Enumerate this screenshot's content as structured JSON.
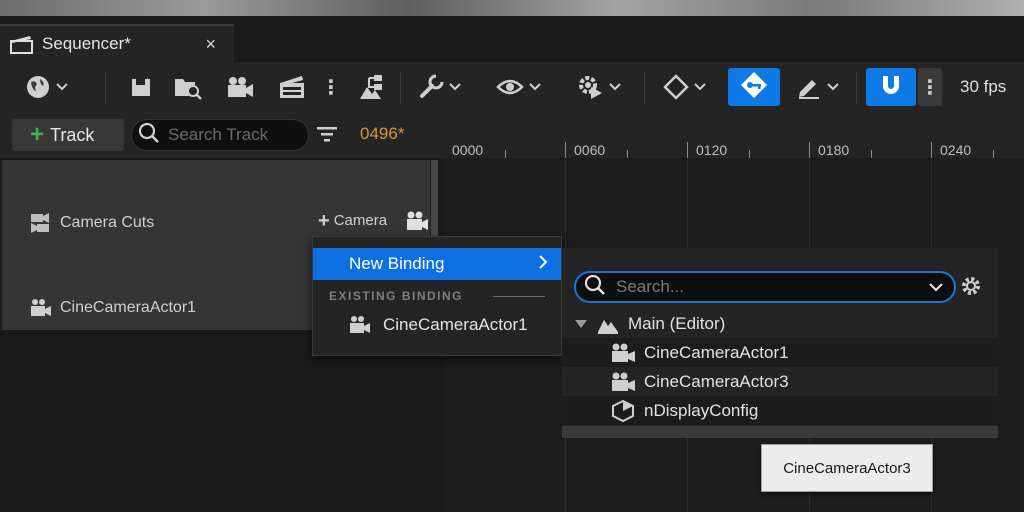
{
  "tab": {
    "title": "Sequencer*",
    "icon": "clapperboard-icon",
    "close": "×"
  },
  "toolbar": {
    "fps": "30 fps",
    "icons": [
      "world-icon",
      "save-icon",
      "browse-asset-icon",
      "camera-icon",
      "render-movie-icon",
      "hierarchy-icon",
      "wrench-icon",
      "eye-icon",
      "playback-gear-icon",
      "key-diamond-icon",
      "auto-key-icon",
      "pencil-icon",
      "magnet-snap-icon"
    ],
    "accent": "#0e7ae6"
  },
  "track_bar": {
    "add_label": "Track",
    "search_placeholder": "Search Track",
    "current_frame": "0496*",
    "frame_color": "#e0942d"
  },
  "timeline": {
    "ticks": [
      "0000",
      "0060",
      "0120",
      "0180",
      "0240"
    ]
  },
  "tracks": {
    "camera_cuts": "Camera Cuts",
    "add_camera": "Camera",
    "binding": "CineCameraActor1"
  },
  "context_menu": {
    "new_binding": "New Binding",
    "section": "EXISTING BINDING",
    "existing": "CineCameraActor1"
  },
  "actor_picker": {
    "search_placeholder": "Search...",
    "tree": {
      "root": "Main (Editor)",
      "items": [
        "CineCameraActor1",
        "CineCameraActor3",
        "nDisplayConfig"
      ]
    }
  },
  "tooltip": "CineCameraActor3"
}
